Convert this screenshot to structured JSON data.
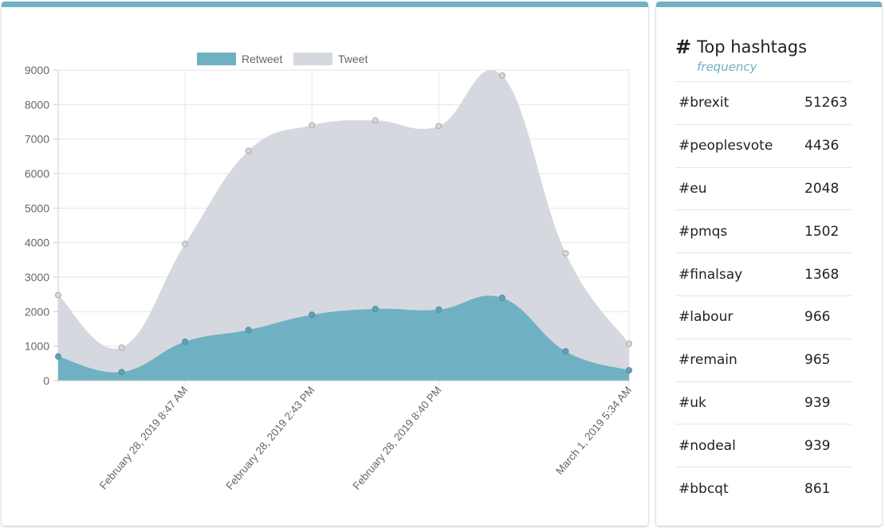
{
  "chart_data": {
    "type": "area",
    "x": [
      "",
      "",
      "February 28, 2019 8:47 AM",
      "",
      "February 28, 2019 2:43 PM",
      "",
      "February 28, 2019 8:40 PM",
      "",
      "",
      "March 1, 2019 5:34 AM"
    ],
    "series": [
      {
        "name": "Retweet",
        "values": [
          700,
          250,
          1130,
          1470,
          1910,
          2080,
          2060,
          2400,
          850,
          300
        ],
        "color": "#6fb1c3"
      },
      {
        "name": "Tweet",
        "values": [
          2480,
          960,
          3960,
          6660,
          7400,
          7540,
          7380,
          8840,
          3690,
          1070
        ],
        "color": "#d6d8df"
      }
    ],
    "ylim": [
      0,
      9000
    ],
    "y_ticks": [
      "0",
      "1000",
      "2000",
      "3000",
      "4000",
      "5000",
      "6000",
      "7000",
      "8000",
      "9000"
    ],
    "grid": true,
    "legend_position": "top-center",
    "xlabel": "",
    "ylabel": ""
  },
  "hashtags": {
    "icon": "hashtag-icon",
    "title": "Top hashtags",
    "subtitle": "frequency",
    "items": [
      {
        "tag": "#brexit",
        "count": "51263"
      },
      {
        "tag": "#peoplesvote",
        "count": "4436"
      },
      {
        "tag": "#eu",
        "count": "2048"
      },
      {
        "tag": "#pmqs",
        "count": "1502"
      },
      {
        "tag": "#finalsay",
        "count": "1368"
      },
      {
        "tag": "#labour",
        "count": "966"
      },
      {
        "tag": "#remain",
        "count": "965"
      },
      {
        "tag": "#uk",
        "count": "939"
      },
      {
        "tag": "#nodeal",
        "count": "939"
      },
      {
        "tag": "#bbcqt",
        "count": "861"
      }
    ]
  },
  "colors": {
    "accent": "#6fb1c3",
    "tweet": "#d6d8df"
  }
}
